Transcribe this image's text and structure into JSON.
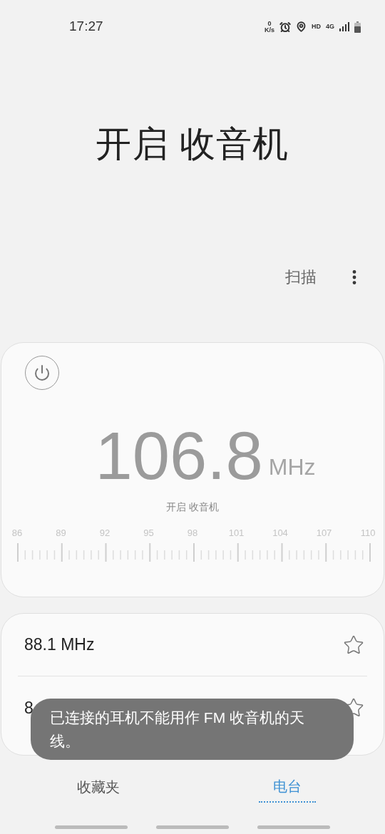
{
  "status_bar": {
    "time": "17:27",
    "speed_value": "0",
    "speed_unit": "K/s",
    "hd": "HD",
    "network": "4G"
  },
  "title": "开启 收音机",
  "toolbar": {
    "scan": "扫描"
  },
  "tuner": {
    "power_on": false,
    "frequency": "106.8",
    "unit": "MHz",
    "status": "开启 收音机",
    "scale_labels": [
      "86",
      "89",
      "92",
      "95",
      "98",
      "101",
      "104",
      "107",
      "110"
    ]
  },
  "stations": [
    {
      "name": "88.1 MHz",
      "favorite": false
    },
    {
      "name": "8",
      "favorite": false
    }
  ],
  "toast": "已连接的耳机不能用作 FM 收音机的天线。",
  "tabs": [
    {
      "label": "收藏夹",
      "selected": false
    },
    {
      "label": "电台",
      "selected": true
    }
  ]
}
